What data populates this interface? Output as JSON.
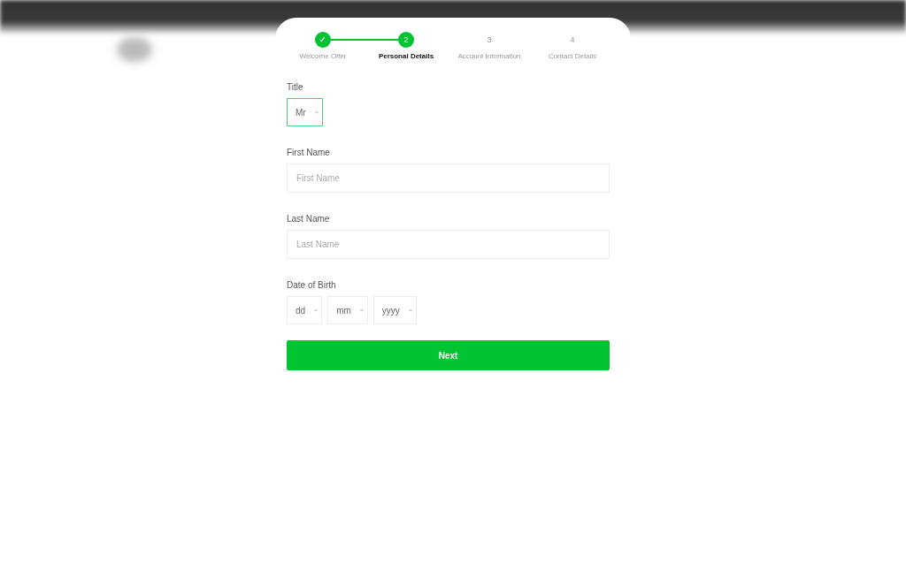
{
  "steps": [
    {
      "number": "✓",
      "label": "Welcome Offer",
      "completed": true,
      "selected": false
    },
    {
      "number": "2",
      "label": "Personal Details",
      "completed": false,
      "selected": true
    },
    {
      "number": "3",
      "label": "Account Information",
      "completed": false,
      "selected": false
    },
    {
      "number": "4",
      "label": "Contact Details",
      "completed": false,
      "selected": false
    }
  ],
  "fields": [
    {
      "kind": "select",
      "label": "Title",
      "parts": [
        {
          "value": "Mr",
          "focused": true
        }
      ]
    },
    {
      "kind": "text",
      "label": "First Name",
      "placeholder": "First Name"
    },
    {
      "kind": "text",
      "label": "Last Name",
      "placeholder": "Last Name"
    },
    {
      "kind": "select",
      "label": "Date of Birth",
      "parts": [
        {
          "value": "dd",
          "focused": false
        },
        {
          "value": "mm",
          "focused": false
        },
        {
          "value": "yyyy",
          "focused": false
        }
      ]
    }
  ],
  "button": "Next"
}
